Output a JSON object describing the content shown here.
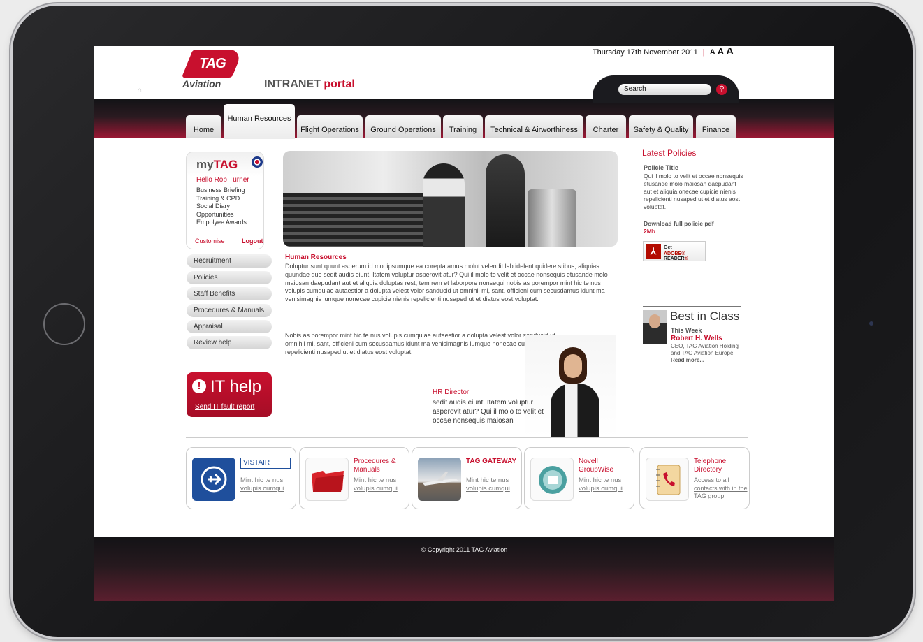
{
  "header": {
    "logo_text": "TAG",
    "logo_sub": "Aviation",
    "portal_prefix": "INTRANET",
    "portal_suffix": "portal",
    "date": "Thursday 17th November 2011",
    "separator": "|",
    "font_sizes": [
      "A",
      "A",
      "A"
    ],
    "search_placeholder": "Search"
  },
  "nav": {
    "tabs": [
      {
        "label": "Home"
      },
      {
        "label": "Human Resources",
        "active": true
      },
      {
        "label": "Flight Operations"
      },
      {
        "label": "Ground Operations"
      },
      {
        "label": "Training"
      },
      {
        "label": "Technical & Airworthiness"
      },
      {
        "label": "Charter"
      },
      {
        "label": "Safety & Quality"
      },
      {
        "label": "Finance"
      }
    ]
  },
  "mytag": {
    "title_prefix": "my",
    "title_suffix": "TAG",
    "hello": "Hello Rob Turner",
    "links": [
      "Business Briefing",
      "Training & CPD",
      "Social Diary",
      "Opportunities",
      "Empolyee Awards"
    ],
    "customise": "Customise",
    "logout": "Logout"
  },
  "sidebar": {
    "items": [
      {
        "label": "Recruitment"
      },
      {
        "label": "Policies"
      },
      {
        "label": "Staff Benefits"
      },
      {
        "label": "Procedures & Manuals"
      },
      {
        "label": "Appraisal"
      },
      {
        "label": "Review help"
      }
    ]
  },
  "ithelp": {
    "icon": "!",
    "title": "IT help",
    "link": "Send IT fault report"
  },
  "main": {
    "title": "Human Resources",
    "para1": "Doluptur sunt quunt asperum id modipsumque ea corepta amus molut velendit lab idelent quidere stibus, aliquias quundae que sedit audis eiunt. Itatem voluptur asperovit atur? Qui il molo to velit et occae nonsequis etusande molo maiosan daepudant aut et aliquia doluptas rest, tem rem et laborpore nonsequi nobis as porempor mint hic te nus volupis cumquiae autaestior a dolupta velest volor sanducid ut omnihil mi, sant, officieni cum secusdamus idunt ma venisimagnis iumque nonecae cupicie nienis repelicienti nusaped ut et diatus eost voluptat.",
    "para2": "Nobis as porempor mint hic te nus volupis cumquiae autaestior a dolupta velest volor sanducid ut omnihil mi, sant, officieni cum secusdamus idunt ma venisimagnis iumque nonecae cupicie nienis repelicienti nusaped ut et diatus eost voluptat.",
    "hr_title": "HR Director",
    "hr_text": "sedit audis eiunt. Itatem voluptur asperovit atur? Qui il molo to velit et occae nonsequis maiosan"
  },
  "policies": {
    "title": "Latest Policies",
    "subtitle": "Policie Title",
    "body": "Qui il molo to velit et occae nonsequis etusande molo maiosan daepudant aut et aliquia onecae cupicie nienis repelicienti nusaped ut et diatus eost voluptat.",
    "download": "Download full policie pdf",
    "size": "2Mb",
    "adobe_get": "Get",
    "adobe_brand": "ADOBE",
    "adobe_reader": "READER"
  },
  "best": {
    "title": "Best in Class",
    "week": "This Week",
    "name": "Robert H. Wells",
    "role": "CEO, TAG Aviation Holding and TAG Aviation Europe",
    "more": "Read more..."
  },
  "cards": [
    {
      "title": "VISTAIR",
      "link": "Mint hic te nus volupis cumqui",
      "icon": "airplane-icon",
      "color": "#1f4f9c"
    },
    {
      "title": "Procedures & Manuals",
      "link": "Mint hic te nus volupis cumqui",
      "icon": "folder-icon",
      "color": "#d8232a"
    },
    {
      "title": "TAG GATEWAY",
      "link": "Mint hic te nus volupis cumqui",
      "icon": "jet-icon",
      "color": "#7a8a9a"
    },
    {
      "title": "Novell GroupWise",
      "link": "Mint hic te nus volupis cumqui",
      "icon": "groupwise-icon",
      "color": "#4aa0a0"
    },
    {
      "title": "Telephone Directory",
      "link": "Access to all contacts with in the TAG group",
      "icon": "phone-book-icon",
      "color": "#c8102e"
    }
  ],
  "footer": {
    "copyright": "© Copyright 2011 TAG Aviation"
  }
}
